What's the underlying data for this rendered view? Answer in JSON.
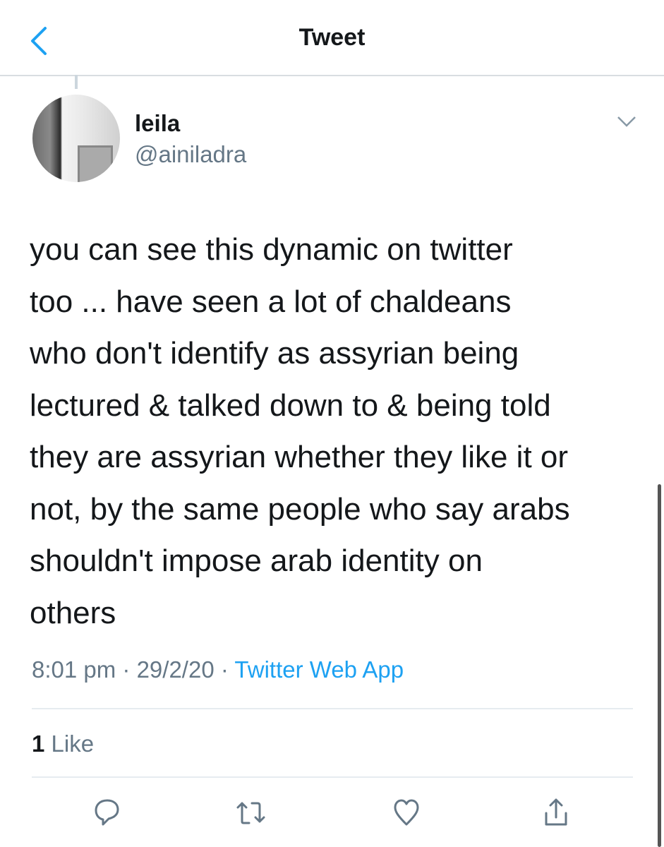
{
  "header": {
    "title": "Tweet"
  },
  "tweet": {
    "author_name": "leila",
    "author_handle": "@ainiladra",
    "text_lines": [
      "you can see this dynamic on twitter",
      "too ... have seen a lot of chaldeans",
      "who don't identify as assyrian being",
      "lectured & talked down to & being told",
      "they are assyrian whether they like it or",
      "not, by the same people who say arabs",
      "shouldn't impose arab identity on",
      "others"
    ],
    "time": "8:01 pm",
    "date": "29/2/20",
    "source": "Twitter Web App",
    "like_count": "1",
    "like_label": "Like"
  },
  "colors": {
    "accent": "#1da1f2",
    "secondary": "#657786"
  },
  "icons": [
    "back-chevron-icon",
    "chevron-down-icon",
    "reply-icon",
    "retweet-icon",
    "heart-icon",
    "share-icon"
  ]
}
